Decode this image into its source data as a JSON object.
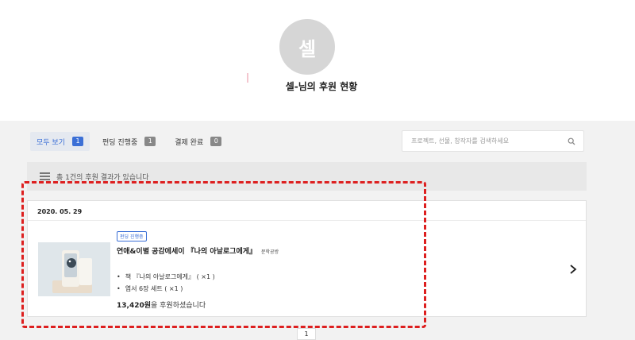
{
  "profile": {
    "avatar_text": "셀",
    "title": "셀-님의 후원 현황"
  },
  "filters": {
    "tabs": [
      {
        "label": "모두 보기",
        "count": "1",
        "active": true
      },
      {
        "label": "펀딩 진행중",
        "count": "1",
        "active": false
      },
      {
        "label": "결제 완료",
        "count": "0",
        "active": false
      }
    ]
  },
  "search": {
    "placeholder": "프로젝트, 선물, 창작자를 검색하세요",
    "icon": "search-icon"
  },
  "summary": {
    "text": "총 1건의 후원 결과가 있습니다",
    "icon": "list-icon"
  },
  "pledges": [
    {
      "date": "2020. 05. 29",
      "status": "펀딩 진행중",
      "title": "연애&이별 공감에세이 『나의 아날로그에게』",
      "creator": "문학공방",
      "items": [
        "책 『나의 아날로그에게』 ( ×1 )",
        "엽서 6장 세트 ( ×1 )"
      ],
      "amount": "13,420원",
      "amount_suffix": "을 후원하셨습니다"
    }
  ],
  "pagination": {
    "current": "1"
  },
  "colors": {
    "accent": "#3b6fd6",
    "highlight_border": "#dd1f1f",
    "background": "#f2f2f2"
  }
}
